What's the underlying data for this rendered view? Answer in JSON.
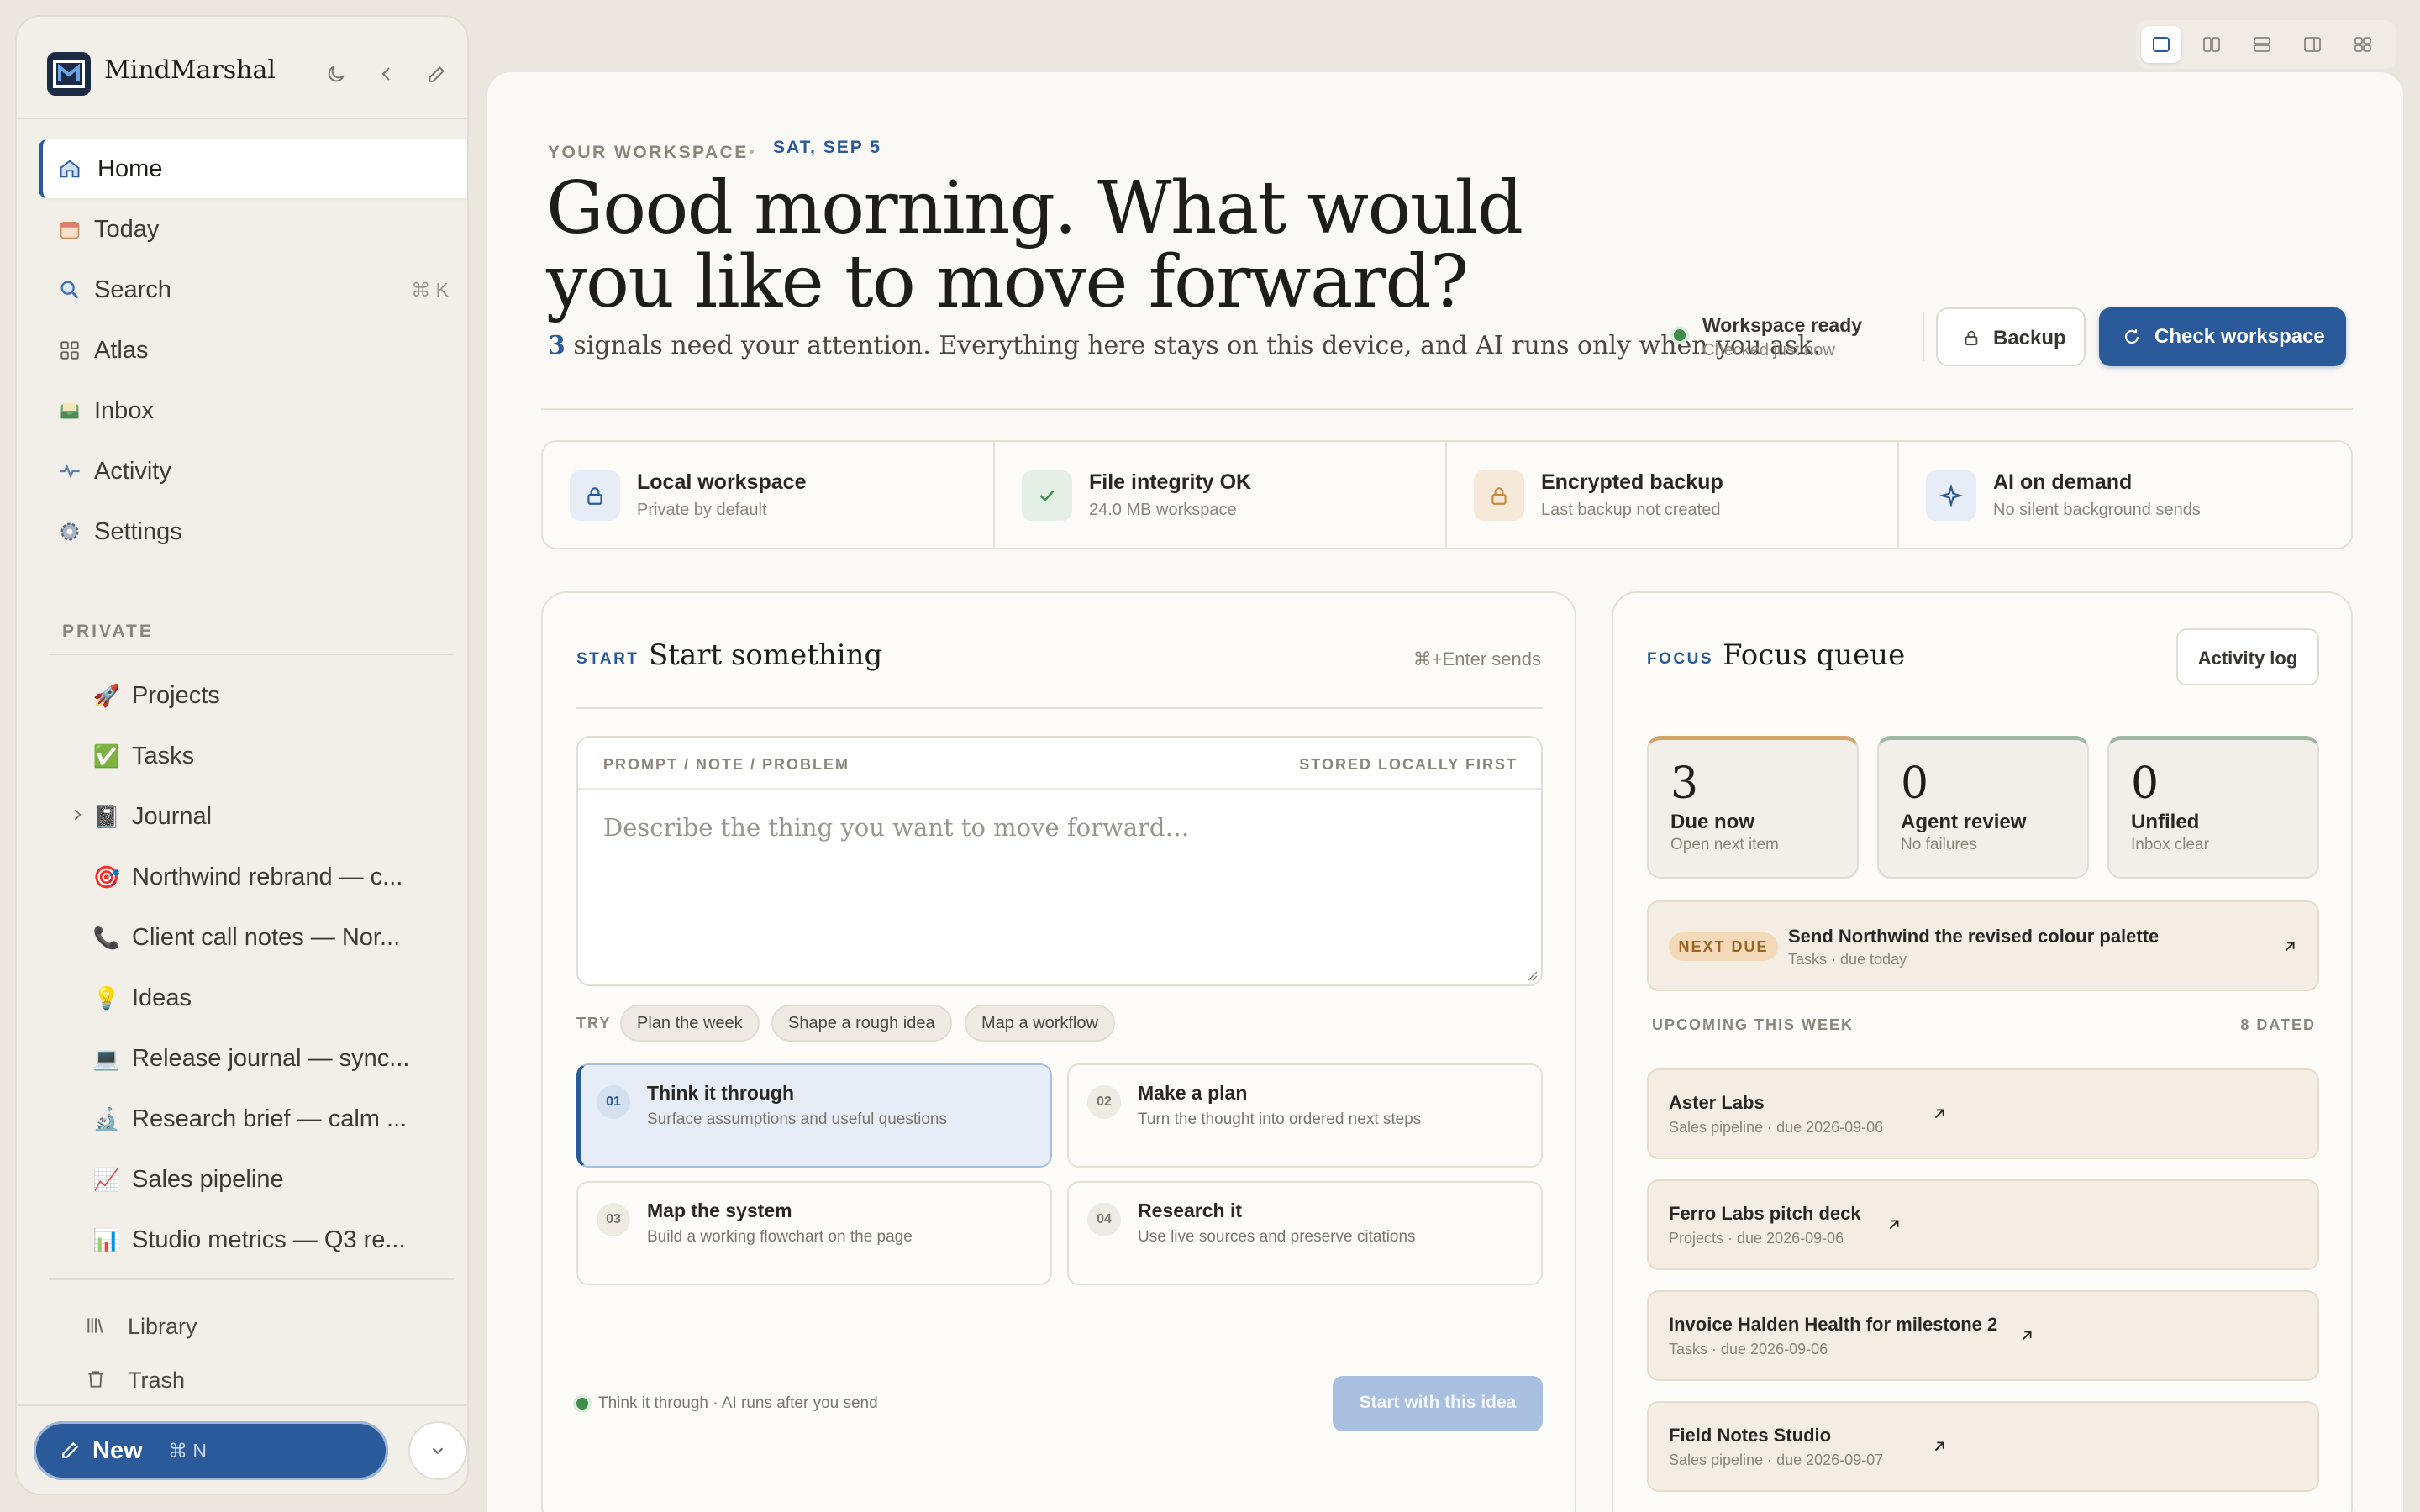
{
  "app": {
    "name": "MindMarshal"
  },
  "sidebar": {
    "nav": [
      {
        "label": "Home",
        "icon": "home-icon"
      },
      {
        "label": "Today",
        "icon": "calendar-icon"
      },
      {
        "label": "Search",
        "icon": "search-icon",
        "shortcut": "⌘ K"
      },
      {
        "label": "Atlas",
        "icon": "grid-icon"
      },
      {
        "label": "Inbox",
        "icon": "inbox-icon"
      },
      {
        "label": "Activity",
        "icon": "activity-icon"
      },
      {
        "label": "Settings",
        "icon": "gear-icon"
      }
    ],
    "private_heading": "PRIVATE",
    "private_items": [
      {
        "label": "Projects",
        "emoji": "🚀"
      },
      {
        "label": "Tasks",
        "emoji": "✅"
      },
      {
        "label": "Journal",
        "emoji": "📓"
      },
      {
        "label": "Northwind rebrand — c...",
        "emoji": "🎯"
      },
      {
        "label": "Client call notes — Nor...",
        "emoji": "📞"
      },
      {
        "label": "Ideas",
        "emoji": "💡"
      },
      {
        "label": "Release journal — sync...",
        "emoji": "💻"
      },
      {
        "label": "Research brief — calm ...",
        "emoji": "🔬"
      },
      {
        "label": "Sales pipeline",
        "emoji": "📈"
      },
      {
        "label": "Studio metrics — Q3 re...",
        "emoji": "📊"
      }
    ],
    "footer": [
      {
        "label": "Library",
        "icon": "library-icon"
      },
      {
        "label": "Trash",
        "icon": "trash-icon"
      }
    ],
    "new_button": {
      "label": "New",
      "shortcut": "⌘ N"
    }
  },
  "header": {
    "eyebrow": "YOUR WORKSPACE",
    "date": "SAT, SEP 5",
    "headline": "Good morning. What would you like to move forward?",
    "signals_count": "3",
    "subline_rest": "signals need your attention. Everything here stays on this device, and AI runs only when you ask.",
    "status_title": "Workspace ready",
    "status_sub": "Checked just now",
    "backup_label": "Backup",
    "check_label": "Check workspace"
  },
  "stats": [
    {
      "title": "Local workspace",
      "sub": "Private by default",
      "icon": "lock-icon",
      "color": "#e7edf6"
    },
    {
      "title": "File integrity OK",
      "sub": "24.0 MB workspace",
      "icon": "check-icon",
      "color": "#e4efe6"
    },
    {
      "title": "Encrypted backup",
      "sub": "Last backup not created",
      "icon": "lock-icon",
      "color": "#f6e9da"
    },
    {
      "title": "AI on demand",
      "sub": "No silent background sends",
      "icon": "sparkle-icon",
      "color": "#e7edf6"
    }
  ],
  "start": {
    "tag": "START",
    "title": "Start something",
    "send_hint": "⌘+Enter sends",
    "prompt_label": "PROMPT / NOTE / PROBLEM",
    "prompt_badge": "STORED LOCALLY FIRST",
    "placeholder": "Describe the thing you want to move forward…",
    "try_label": "TRY",
    "chips": [
      "Plan the week",
      "Shape a rough idea",
      "Map a workflow"
    ],
    "modes": [
      {
        "num": "01",
        "title": "Think it through",
        "sub": "Surface assumptions and useful questions"
      },
      {
        "num": "02",
        "title": "Make a plan",
        "sub": "Turn the thought into ordered next steps"
      },
      {
        "num": "03",
        "title": "Map the system",
        "sub": "Build a working flowchart on the page"
      },
      {
        "num": "04",
        "title": "Research it",
        "sub": "Use live sources and preserve citations"
      }
    ],
    "footer_note": "Think it through · AI runs after you send",
    "start_button": "Start with this idea"
  },
  "focus": {
    "tag": "FOCUS",
    "title": "Focus queue",
    "activity_log": "Activity log",
    "queue": [
      {
        "count": "3",
        "title": "Due now",
        "sub": "Open next item",
        "accent": "#d4a46a"
      },
      {
        "count": "0",
        "title": "Agent review",
        "sub": "No failures",
        "accent": "#9fb8a2"
      },
      {
        "count": "0",
        "title": "Unfiled",
        "sub": "Inbox clear",
        "accent": "#9fb8a2"
      }
    ],
    "next_due": {
      "badge": "NEXT DUE",
      "title": "Send Northwind the revised colour palette",
      "sub": "Tasks · due today"
    },
    "upcoming_heading": "UPCOMING THIS WEEK",
    "upcoming_count": "8 DATED",
    "upcoming": [
      {
        "title": "Aster Labs",
        "sub": "Sales pipeline · due 2026-09-06"
      },
      {
        "title": "Ferro Labs pitch deck",
        "sub": "Projects · due 2026-09-06"
      },
      {
        "title": "Invoice Halden Health for milestone 2",
        "sub": "Tasks · due 2026-09-06"
      },
      {
        "title": "Field Notes Studio",
        "sub": "Sales pipeline · due 2026-09-07"
      }
    ]
  },
  "colors": {
    "accent": "#2a5a9a",
    "success": "#3f8c4e",
    "warning": "#d4a46a"
  }
}
